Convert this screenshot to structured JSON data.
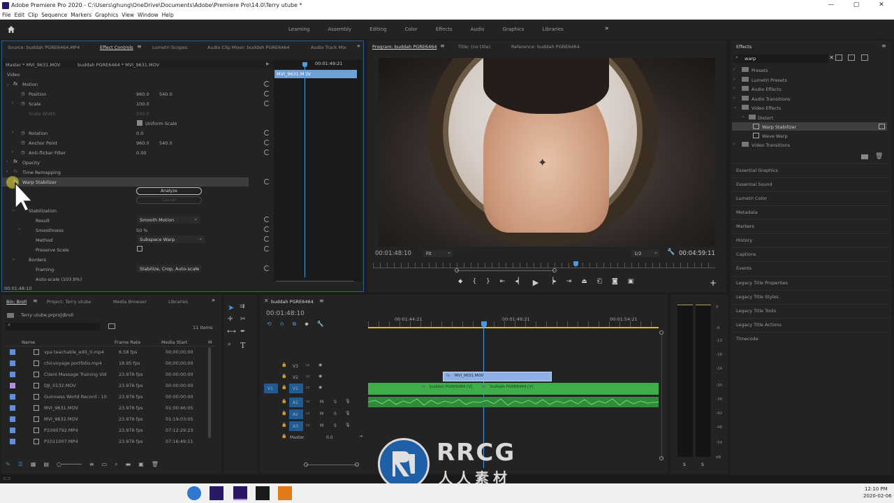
{
  "window": {
    "title": "Adobe Premiere Pro 2020 - C:\\Users\\ghung\\OneDrive\\Documents\\Adobe\\Premiere Pro\\14.0\\Terry utube *",
    "controls": [
      "—",
      "▢",
      "✕"
    ]
  },
  "menu": [
    "File",
    "Edit",
    "Clip",
    "Sequence",
    "Markers",
    "Graphics",
    "View",
    "Window",
    "Help"
  ],
  "workspaces": [
    "Learning",
    "Assembly",
    "Editing",
    "Color",
    "Effects",
    "Audio",
    "Graphics",
    "Libraries"
  ],
  "source_panel": {
    "tabs": [
      "Source: buddah PGRE6464.MP4",
      "Effect Controls",
      "Lumetri Scopes",
      "Audio Clip Mixer: buddah PGRE6464",
      "Audio Track Mix"
    ],
    "master": "Master * MVI_9631.MOV",
    "clip": "buddah PGRE6464 * MVI_9631.MOV",
    "timecode_top": "00:01:49:21",
    "clip_bar": "MVI_9631.MOV",
    "video_label": "Video",
    "motion": "Motion",
    "position": {
      "label": "Position",
      "x": "960.0",
      "y": "540.0"
    },
    "scale": {
      "label": "Scale",
      "value": "100.0"
    },
    "scale_width": {
      "label": "Scale Width",
      "value": "100.0"
    },
    "uniform_scale": "Uniform Scale",
    "rotation": {
      "label": "Rotation",
      "value": "0.0"
    },
    "anchor_point": {
      "label": "Anchor Point",
      "x": "960.0",
      "y": "540.0"
    },
    "anti_flicker": {
      "label": "Anti-flicker Filter",
      "value": "0.00"
    },
    "opacity": "Opacity",
    "time_remapping": "Time Remapping",
    "warp_stabilizer": "Warp Stabilizer",
    "analyze": "Analyze",
    "cancel": "Cancel",
    "stabilization": "Stabilization",
    "result": {
      "label": "Result",
      "value": "Smooth Motion"
    },
    "smoothness": {
      "label": "Smoothness",
      "value": "50 %"
    },
    "method": {
      "label": "Method",
      "value": "Subspace Warp"
    },
    "preserve_scale": "Preserve Scale",
    "borders": "Borders",
    "framing": {
      "label": "Framing",
      "value": "Stabilize, Crop, Auto-scale"
    },
    "auto_scale": "Auto-scale (103.9%)",
    "timecode_bottom": "00:01:48:10"
  },
  "program": {
    "tabs": [
      "Program: buddah PGRE6464",
      "Title: (no title)",
      "Reference: buddah PGRE6464"
    ],
    "timecode": "00:01:48:10",
    "fit": "Fit",
    "ratio": "1/2",
    "duration": "00:04:59:11"
  },
  "effects_panel": {
    "title": "Effects",
    "search": "warp",
    "tree": [
      "Presets",
      "Lumetri Presets",
      "Audio Effects",
      "Audio Transitions",
      "Video Effects",
      "Distort",
      "Warp Stabilizer",
      "Wave Warp",
      "Video Transitions"
    ],
    "sections": [
      "Essential Graphics",
      "Essential Sound",
      "Lumetri Color",
      "Metadata",
      "Markers",
      "History",
      "Captions",
      "Events",
      "Legacy Title Properties",
      "Legacy Title Styles",
      "Legacy Title Tools",
      "Legacy Title Actions",
      "Timecode"
    ]
  },
  "bin": {
    "tabs": [
      "Bin: Broll",
      "Project: Terry utube",
      "Media Browser",
      "Libraries"
    ],
    "path": "Terry utube.prproj\\Broll",
    "count": "11 Items",
    "columns": [
      "Name",
      "Frame Rate",
      "Media Start",
      "M"
    ],
    "rows": [
      {
        "name": "vpa teachable_edit_0.mp4",
        "fps": "6.58 fps",
        "start": "00;00;00;00",
        "color": "#5b8fe0"
      },
      {
        "name": "chicvoyage portfolio.mp4",
        "fps": "18.95 fps",
        "start": "00;00;00;00",
        "color": "#5b8fe0"
      },
      {
        "name": "Client Massage Training Vid",
        "fps": "23.976 fps",
        "start": "00:00:00:00",
        "color": "#5b8fe0"
      },
      {
        "name": "DJI_0132.MOV",
        "fps": "23.976 fps",
        "start": "00:00:00:00",
        "color": "#b48be0"
      },
      {
        "name": "Guinness World Record - 10",
        "fps": "23.976 fps",
        "start": "00:00:00:00",
        "color": "#5b8fe0"
      },
      {
        "name": "MVI_9631.MOV",
        "fps": "23.976 fps",
        "start": "01:00:46:05",
        "color": "#5b8fe0"
      },
      {
        "name": "MVI_9632.MOV",
        "fps": "23.976 fps",
        "start": "01:19:03:05",
        "color": "#5b8fe0"
      },
      {
        "name": "P1000792.MP4",
        "fps": "23.976 fps",
        "start": "07:12:29:23",
        "color": "#5b8fe0"
      },
      {
        "name": "P1011007.MP4",
        "fps": "23.976 fps",
        "start": "07:16:49:11",
        "color": "#5b8fe0"
      }
    ]
  },
  "timeline": {
    "title": "buddah PGRE6464",
    "timecode": "00:01:48:10",
    "ruler": [
      "00:01:44:21",
      "00:01:49:21",
      "00:01:54:21"
    ],
    "video_tracks": [
      "V3",
      "V2",
      "V1"
    ],
    "audio_tracks": [
      "A1",
      "A2",
      "A3"
    ],
    "master": "Master",
    "master_value": "0.0",
    "source_patch": "V1",
    "clips": {
      "v2": "MVI_9631.MOV",
      "v1a": "buddah PGRE6464 [V]",
      "v1b": "buddah PGRE6464 [V]"
    }
  },
  "meters": [
    "0",
    "-6",
    "-12",
    "-18",
    "-24",
    "-30",
    "-36",
    "-42",
    "-48",
    "-54",
    "dB"
  ],
  "meter_solo": [
    "S",
    "S"
  ],
  "taskbar": {
    "time": "12:10 PM",
    "date": "2020-02-06"
  },
  "watermark": {
    "name": "RRCG",
    "sub": "人人素材"
  }
}
